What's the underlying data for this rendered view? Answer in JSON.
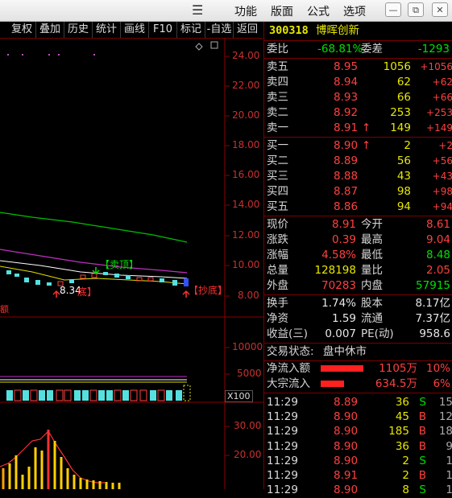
{
  "menu": {
    "items": [
      "功能",
      "版面",
      "公式",
      "选项"
    ],
    "minimize": "—",
    "restore": "⧉",
    "close": "✕"
  },
  "toolbar": [
    "复权",
    "叠加",
    "历史",
    "统计",
    "画线",
    "F10",
    "标记",
    "-自选",
    "返回"
  ],
  "price_axis": [
    "24.00",
    "22.00",
    "20.00",
    "18.00",
    "16.00",
    "14.00",
    "12.00",
    "10.00",
    "8.00"
  ],
  "volume_axis": [
    "10000",
    "5000"
  ],
  "volume_unit": "X100",
  "indicator_axis": [
    "30.00",
    "20.00"
  ],
  "chart_labels": {
    "sell_signal": "【卖顶】",
    "buy_signal": "【抄底】",
    "low_price": "8.34",
    "low_label": "底】",
    "partial_label": "额"
  },
  "quote": {
    "code": "300318",
    "name": "博晖创新",
    "webi_label": "委比",
    "webi_value": "-68.81%",
    "weicha_label": "委差",
    "weicha_value": "-1293",
    "sells": [
      {
        "label": "卖五",
        "price": "8.95",
        "vol": "1056",
        "chg": "+1056",
        "arrow": ""
      },
      {
        "label": "卖四",
        "price": "8.94",
        "vol": "62",
        "chg": "+62",
        "arrow": ""
      },
      {
        "label": "卖三",
        "price": "8.93",
        "vol": "66",
        "chg": "+66",
        "arrow": ""
      },
      {
        "label": "卖二",
        "price": "8.92",
        "vol": "253",
        "chg": "+253",
        "arrow": ""
      },
      {
        "label": "卖一",
        "price": "8.91",
        "vol": "149",
        "chg": "+149",
        "arrow": "↑"
      }
    ],
    "buys": [
      {
        "label": "买一",
        "price": "8.90",
        "vol": "2",
        "chg": "+2",
        "arrow": "↑"
      },
      {
        "label": "买二",
        "price": "8.89",
        "vol": "56",
        "chg": "+56",
        "arrow": ""
      },
      {
        "label": "买三",
        "price": "8.88",
        "vol": "43",
        "chg": "+43",
        "arrow": ""
      },
      {
        "label": "买四",
        "price": "8.87",
        "vol": "98",
        "chg": "+98",
        "arrow": ""
      },
      {
        "label": "买五",
        "price": "8.86",
        "vol": "94",
        "chg": "+94",
        "arrow": ""
      }
    ],
    "stats": [
      {
        "l1": "现价",
        "v1": "8.91",
        "l2": "今开",
        "v2": "8.61",
        "c2": "red"
      },
      {
        "l1": "涨跌",
        "v1": "0.39",
        "l2": "最高",
        "v2": "9.04",
        "c2": "red"
      },
      {
        "l1": "涨幅",
        "v1": "4.58%",
        "l2": "最低",
        "v2": "8.48",
        "c2": "green"
      },
      {
        "l1": "总量",
        "v1": "128198",
        "l2": "量比",
        "v2": "2.05",
        "c2": "red"
      },
      {
        "l1": "外盘",
        "v1": "70283",
        "l2": "内盘",
        "v2": "57915",
        "c2": "green"
      }
    ],
    "fund": [
      {
        "l1": "换手",
        "v1": "1.74%",
        "l2": "股本",
        "v2": "8.17亿"
      },
      {
        "l1": "净资",
        "v1": "1.59",
        "l2": "流通",
        "v2": "7.37亿"
      },
      {
        "l1": "收益(三)",
        "v1": "0.007",
        "l2": "PE(动)",
        "v2": "958.6"
      }
    ],
    "status_label": "交易状态:",
    "status_value": "盘中休市",
    "flows": [
      {
        "label": "净流入额",
        "value": "1105万",
        "pct": "10%",
        "fill": 0.48
      },
      {
        "label": "大宗流入",
        "value": "634.5万",
        "pct": "6%",
        "fill": 0.26
      }
    ],
    "ticks": [
      {
        "time": "11:29",
        "price": "8.89",
        "vol": "36",
        "bs": "S",
        "n": "15"
      },
      {
        "time": "11:29",
        "price": "8.90",
        "vol": "45",
        "bs": "B",
        "n": "12"
      },
      {
        "time": "11:29",
        "price": "8.90",
        "vol": "185",
        "bs": "B",
        "n": "18"
      },
      {
        "time": "11:29",
        "price": "8.90",
        "vol": "36",
        "bs": "B",
        "n": "9"
      },
      {
        "time": "11:29",
        "price": "8.90",
        "vol": "2",
        "bs": "S",
        "n": "1"
      },
      {
        "time": "11:29",
        "price": "8.91",
        "vol": "2",
        "bs": "B",
        "n": "1"
      },
      {
        "time": "11:29",
        "price": "8.90",
        "vol": "8",
        "bs": "S",
        "n": "1"
      }
    ]
  }
}
